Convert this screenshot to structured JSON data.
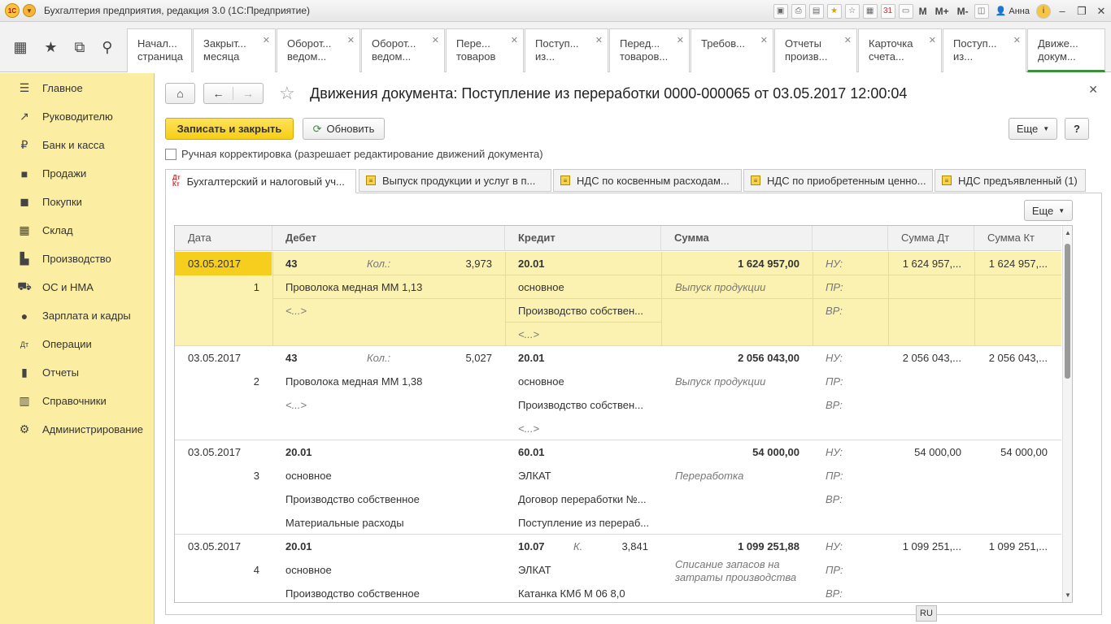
{
  "titlebar": {
    "title": "Бухгалтерия предприятия, редакция 3.0  (1С:Предприятие)",
    "m": "M",
    "mplus": "M+",
    "mminus": "M-",
    "user": "Анна"
  },
  "open_tabs": [
    {
      "line1": "Начал...",
      "line2": "страница"
    },
    {
      "line1": "Закрыт...",
      "line2": "месяца"
    },
    {
      "line1": "Оборот...",
      "line2": "ведом..."
    },
    {
      "line1": "Оборот...",
      "line2": "ведом..."
    },
    {
      "line1": "Пере...",
      "line2": "товаров"
    },
    {
      "line1": "Поступ...",
      "line2": "из..."
    },
    {
      "line1": "Перед...",
      "line2": "товаров..."
    },
    {
      "line1": "Требов...",
      "line2": ""
    },
    {
      "line1": "Отчеты",
      "line2": "произв..."
    },
    {
      "line1": "Карточка",
      "line2": "счета..."
    },
    {
      "line1": "Поступ...",
      "line2": "из..."
    },
    {
      "line1": "Движе...",
      "line2": "докум..."
    }
  ],
  "sidebar": {
    "items": [
      {
        "label": "Главное",
        "icon": "menu-lines-icon"
      },
      {
        "label": "Руководителю",
        "icon": "trend-chart-icon"
      },
      {
        "label": "Банк и касса",
        "icon": "ruble-coin-icon"
      },
      {
        "label": "Продажи",
        "icon": "shopping-bag-icon"
      },
      {
        "label": "Покупки",
        "icon": "cart-icon"
      },
      {
        "label": "Склад",
        "icon": "warehouse-icon"
      },
      {
        "label": "Производство",
        "icon": "factory-icon"
      },
      {
        "label": "ОС и НМА",
        "icon": "truck-icon"
      },
      {
        "label": "Зарплата и кадры",
        "icon": "people-icon"
      },
      {
        "label": "Операции",
        "icon": "debit-credit-icon"
      },
      {
        "label": "Отчеты",
        "icon": "bar-chart-icon"
      },
      {
        "label": "Справочники",
        "icon": "book-icon"
      },
      {
        "label": "Администрирование",
        "icon": "gear-icon"
      }
    ]
  },
  "document": {
    "title": "Движения документа: Поступление из переработки 0000-000065 от 03.05.2017 12:00:04",
    "save_close": "Записать и закрыть",
    "refresh": "Обновить",
    "more": "Еще",
    "help": "?",
    "manual_edit": "Ручная корректировка (разрешает редактирование движений документа)",
    "tabs": [
      "Бухгалтерский и налоговый уч...",
      "Выпуск продукции и услуг в п...",
      "НДС по косвенным расходам...",
      "НДС по приобретенным ценно...",
      "НДС предъявленный (1)"
    ],
    "table_more": "Еще"
  },
  "table": {
    "headers": {
      "date": "Дата",
      "debit": "Дебет",
      "credit": "Кредит",
      "sum": "Сумма",
      "sum_dt": "Сумма Дт",
      "sum_kt": "Сумма Кт"
    },
    "rows": [
      {
        "date": "03.05.2017",
        "num": "1",
        "debit": [
          "43",
          "Проволока медная ММ 1,13",
          "<...>"
        ],
        "debit_qty_label": "Кол.:",
        "debit_qty": "3,973",
        "credit": [
          "20.01",
          "основное",
          "Производство собствен...",
          "<...>"
        ],
        "credit_qty_label": "",
        "credit_qty": "",
        "sum": "1 624 957,00",
        "content": "Выпуск продукции",
        "nu": "НУ:",
        "pr": "ПР:",
        "vr": "ВР:",
        "sum_dt": "1 624 957,...",
        "sum_kt": "1 624 957,..."
      },
      {
        "date": "03.05.2017",
        "num": "2",
        "debit": [
          "43",
          "Проволока медная ММ 1,38",
          "<...>"
        ],
        "debit_qty_label": "Кол.:",
        "debit_qty": "5,027",
        "credit": [
          "20.01",
          "основное",
          "Производство собствен...",
          "<...>"
        ],
        "credit_qty_label": "",
        "credit_qty": "",
        "sum": "2 056 043,00",
        "content": "Выпуск продукции",
        "nu": "НУ:",
        "pr": "ПР:",
        "vr": "ВР:",
        "sum_dt": "2 056 043,...",
        "sum_kt": "2 056 043,..."
      },
      {
        "date": "03.05.2017",
        "num": "3",
        "debit": [
          "20.01",
          "основное",
          "Производство собственное",
          "Материальные расходы"
        ],
        "debit_qty_label": "",
        "debit_qty": "",
        "credit": [
          "60.01",
          "ЭЛКАТ",
          "Договор переработки №...",
          "Поступление из перераб..."
        ],
        "credit_qty_label": "",
        "credit_qty": "",
        "sum": "54 000,00",
        "content": "Переработка",
        "nu": "НУ:",
        "pr": "ПР:",
        "vr": "ВР:",
        "sum_dt": "54 000,00",
        "sum_kt": "54 000,00"
      },
      {
        "date": "03.05.2017",
        "num": "4",
        "debit": [
          "20.01",
          "основное",
          "Производство собственное"
        ],
        "debit_qty_label": "",
        "debit_qty": "",
        "credit": [
          "10.07",
          "ЭЛКАТ",
          "Катанка КМб М 06 8,0"
        ],
        "credit_qty_label": "К.",
        "credit_qty": "3,841",
        "sum": "1 099 251,88",
        "content": "Списание запасов на затраты производства",
        "content_line1": "Списание запасов на",
        "content_line2": "затраты производства",
        "nu": "НУ:",
        "pr": "ПР:",
        "vr": "ВР:",
        "sum_dt": "1 099 251,...",
        "sum_kt": "1 099 251,..."
      }
    ]
  },
  "status": {
    "lang": "RU"
  }
}
